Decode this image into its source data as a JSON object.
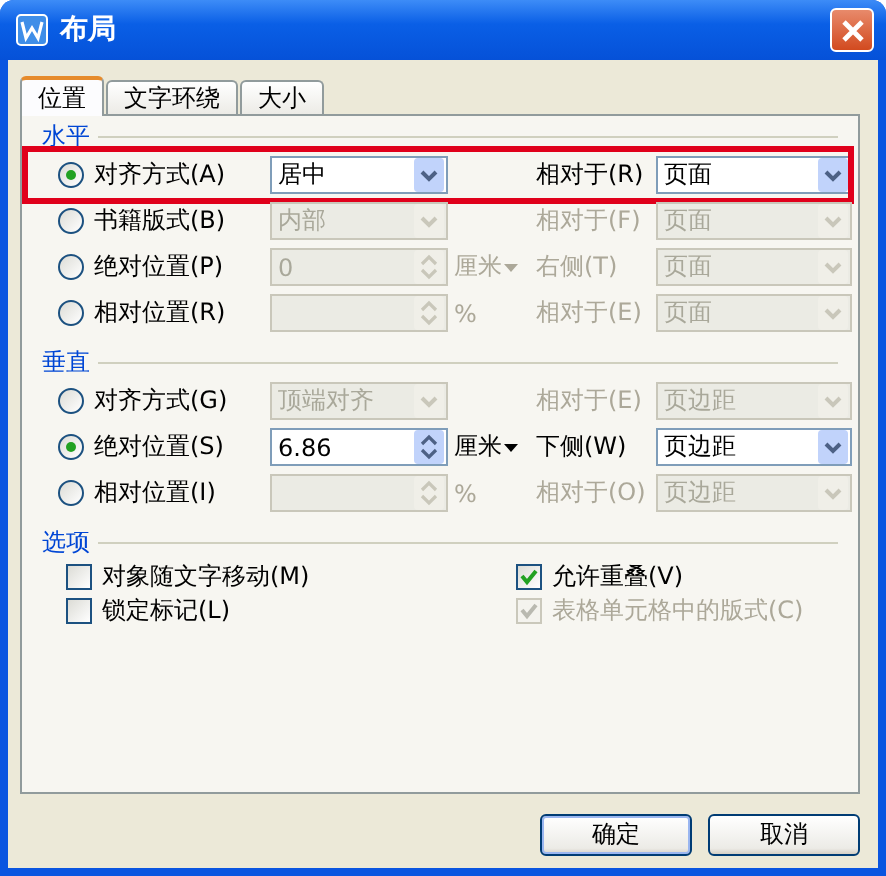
{
  "window": {
    "title": "布局"
  },
  "tabs": [
    {
      "label": "位置",
      "selected": true
    },
    {
      "label": "文字环绕",
      "selected": false
    },
    {
      "label": "大小",
      "selected": false
    }
  ],
  "sections": [
    {
      "title": "水平",
      "rows": [
        {
          "label": "对齐方式(A)",
          "selected": true,
          "highlighted": true,
          "control": {
            "kind": "dropdown",
            "value": "居中",
            "disabled": false
          },
          "relation": {
            "label": "相对于(R)",
            "value": "页面",
            "disabled": false
          }
        },
        {
          "label": "书籍版式(B)",
          "selected": false,
          "highlighted": false,
          "control": {
            "kind": "dropdown",
            "value": "内部",
            "disabled": true
          },
          "relation": {
            "label": "相对于(F)",
            "value": "页面",
            "disabled": true
          }
        },
        {
          "label": "绝对位置(P)",
          "selected": false,
          "highlighted": false,
          "control": {
            "kind": "spin",
            "value": "0",
            "disabled": true
          },
          "unit": {
            "text": "厘米",
            "caret": true,
            "disabled": true
          },
          "relation": {
            "label": "右侧(T)",
            "value": "页面",
            "disabled": true
          }
        },
        {
          "label": "相对位置(R)",
          "selected": false,
          "highlighted": false,
          "control": {
            "kind": "spin",
            "disabled": true
          },
          "unit": {
            "text": "%",
            "caret": false,
            "disabled": true
          },
          "relation": {
            "label": "相对于(E)",
            "value": "页面",
            "disabled": true
          }
        }
      ]
    },
    {
      "title": "垂直",
      "rows": [
        {
          "label": "对齐方式(G)",
          "selected": false,
          "highlighted": false,
          "control": {
            "kind": "dropdown",
            "value": "顶端对齐",
            "disabled": true
          },
          "relation": {
            "label": "相对于(E)",
            "value": "页边距",
            "disabled": true
          }
        },
        {
          "label": "绝对位置(S)",
          "selected": true,
          "highlighted": false,
          "control": {
            "kind": "spin",
            "value": "6.86",
            "disabled": false
          },
          "unit": {
            "text": "厘米",
            "caret": true,
            "disabled": false
          },
          "relation": {
            "label": "下侧(W)",
            "value": "页边距",
            "disabled": false
          }
        },
        {
          "label": "相对位置(I)",
          "selected": false,
          "highlighted": false,
          "control": {
            "kind": "spin",
            "disabled": true
          },
          "unit": {
            "text": "%",
            "caret": false,
            "disabled": true
          },
          "relation": {
            "label": "相对于(O)",
            "value": "页边距",
            "disabled": true
          }
        }
      ]
    }
  ],
  "options": {
    "title": "选项",
    "columns": [
      [
        {
          "label": "对象随文字移动(M)",
          "checked": false,
          "disabled": false
        },
        {
          "label": "锁定标记(L)",
          "checked": false,
          "disabled": false
        }
      ],
      [
        {
          "label": "允许重叠(V)",
          "checked": true,
          "disabled": false
        },
        {
          "label": "表格单元格中的版式(C)",
          "checked": true,
          "disabled": true
        }
      ]
    ]
  },
  "buttons": [
    "确定",
    "取消"
  ]
}
